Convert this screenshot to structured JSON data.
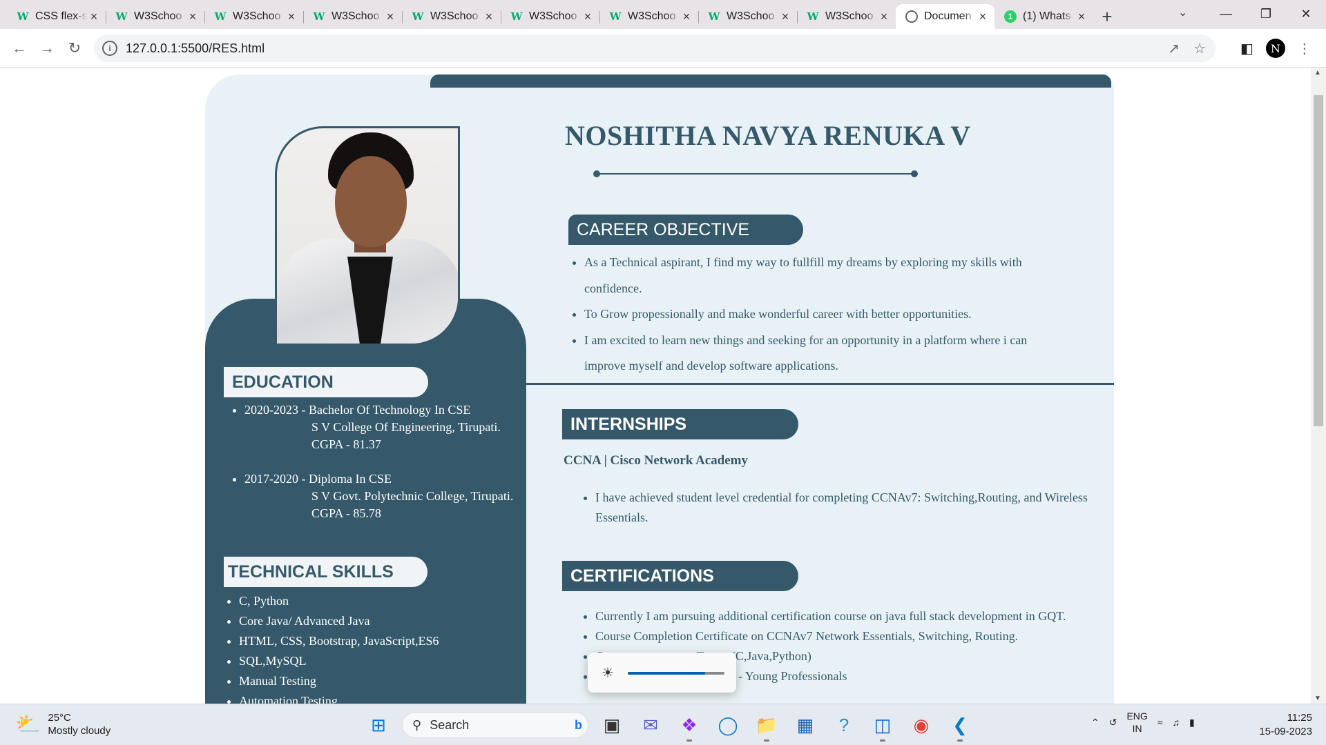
{
  "browser": {
    "tabs": [
      {
        "title": "CSS flex-s",
        "icon": "w3schools-icon"
      },
      {
        "title": "W3Schoo",
        "icon": "w3schools-icon"
      },
      {
        "title": "W3Schoo",
        "icon": "w3schools-icon"
      },
      {
        "title": "W3Schoo",
        "icon": "w3schools-icon"
      },
      {
        "title": "W3Schoo",
        "icon": "w3schools-icon"
      },
      {
        "title": "W3Schoo",
        "icon": "w3schools-icon"
      },
      {
        "title": "W3Schoo",
        "icon": "w3schools-icon"
      },
      {
        "title": "W3Schoo",
        "icon": "w3schools-icon"
      },
      {
        "title": "W3Schoo",
        "icon": "w3schools-icon"
      },
      {
        "title": "Documen",
        "icon": "globe-icon",
        "active": true
      },
      {
        "title": "(1) Whats",
        "icon": "whatsapp-icon"
      }
    ],
    "url": "127.0.0.1:5500/RES.html",
    "profile_initial": "N"
  },
  "resume": {
    "name": "NOSHITHA NAVYA RENUKA V",
    "career_objective": {
      "heading": "CAREER OBJECTIVE",
      "items": [
        "As a Technical aspirant, I find my way to fullfill my dreams by exploring my skills with confidence.",
        "To Grow propessionally and make wonderful career with better opportunities.",
        "I am excited to learn new things and seeking for an opportunity in a platform where i can improve myself and develop software applications."
      ]
    },
    "education": {
      "heading": "EDUCATION",
      "items": [
        {
          "line1": "2020-2023 - Bachelor Of Technology In CSE",
          "line2": "S V College Of Engineering, Tirupati.",
          "line3": "CGPA - 81.37"
        },
        {
          "line1": "2017-2020 - Diploma In CSE",
          "line2": "S V Govt. Polytechnic College, Tirupati.",
          "line3": "CGPA - 85.78"
        }
      ]
    },
    "technical_skills": {
      "heading": "TECHNICAL SKILLS",
      "items": [
        "C, Python",
        "Core Java/ Advanced Java",
        "HTML, CSS, Bootstrap, JavaScript,ES6",
        "SQL,MySQL",
        "Manual Testing",
        "Automation Testing"
      ]
    },
    "internships": {
      "heading": "INTERNSHIPS",
      "title": "CCNA | Cisco Network Academy",
      "items": [
        "I have achieved student level credential for completing CCNAv7: Switching,Routing, and Wireless Essentials."
      ]
    },
    "certifications": {
      "heading": "CERTIFICATIONS",
      "items": [
        "Currently I am pursuing additional certification course on java full stack development in GQT.",
        "Course Completion Certificate on CCNAv7 Network Essentials, Switching, Routing.",
        "C                              Tantra (C,Java,Python)",
        "C                              er Edge - Young Professionals"
      ]
    }
  },
  "brightness": {
    "level": 0.8
  },
  "taskbar": {
    "weather_temp": "25°C",
    "weather_desc": "Mostly cloudy",
    "search_placeholder": "Search",
    "lang_line1": "ENG",
    "lang_line2": "IN",
    "time": "11:25",
    "date": "15-09-2023"
  },
  "colors": {
    "accent": "#35596b",
    "card_bg": "#e8f1f5"
  }
}
